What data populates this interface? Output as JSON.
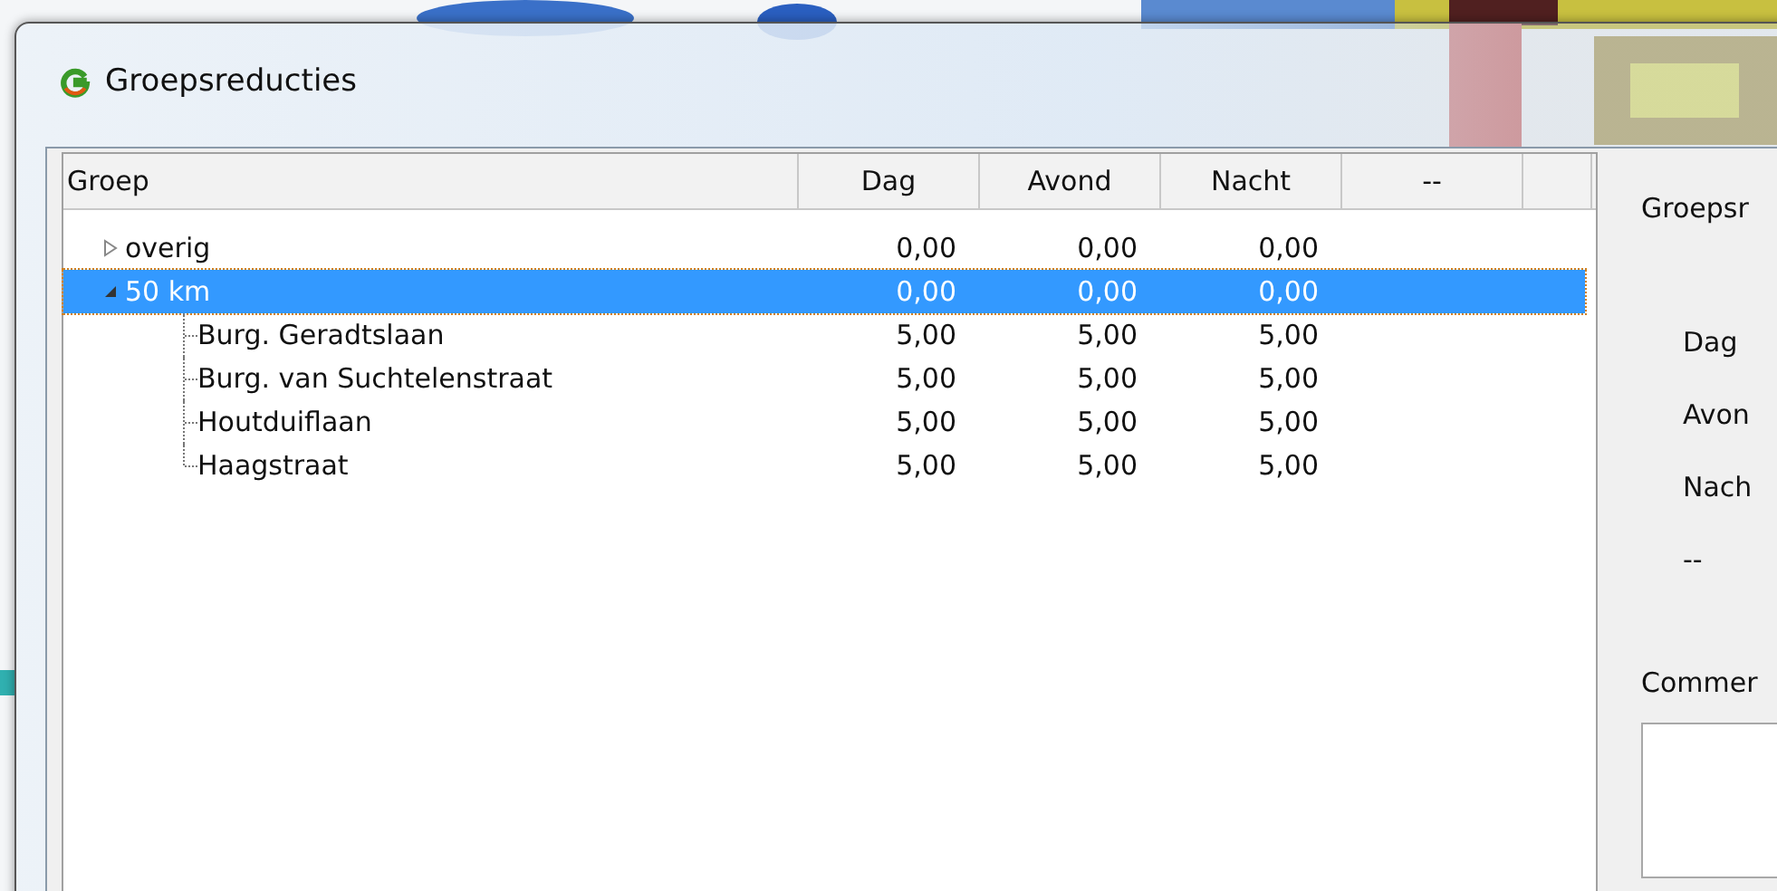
{
  "window": {
    "title": "Groepsreducties"
  },
  "tree": {
    "columns": [
      "Groep",
      "Dag",
      "Avond",
      "Nacht",
      "--"
    ],
    "rows": [
      {
        "name": "overig",
        "values": [
          "0,00",
          "0,00",
          "0,00"
        ],
        "expanded": false,
        "selected": false,
        "children": []
      },
      {
        "name": "50 km",
        "values": [
          "0,00",
          "0,00",
          "0,00"
        ],
        "expanded": true,
        "selected": true,
        "children": [
          {
            "name": "Burg. Geradtslaan",
            "values": [
              "5,00",
              "5,00",
              "5,00"
            ],
            "selected": false
          },
          {
            "name": "Burg. van Suchtelenstraat",
            "values": [
              "5,00",
              "5,00",
              "5,00"
            ],
            "selected": false
          },
          {
            "name": "Houtduiflaan",
            "values": [
              "5,00",
              "5,00",
              "5,00"
            ],
            "selected": false
          },
          {
            "name": "Haagstraat",
            "values": [
              "5,00",
              "5,00",
              "5,00"
            ],
            "selected": false
          }
        ]
      }
    ]
  },
  "details": {
    "heading": "Groepsr",
    "fields": [
      "Dag",
      "Avon",
      "Nach",
      "--"
    ],
    "comment_label": "Commer"
  }
}
